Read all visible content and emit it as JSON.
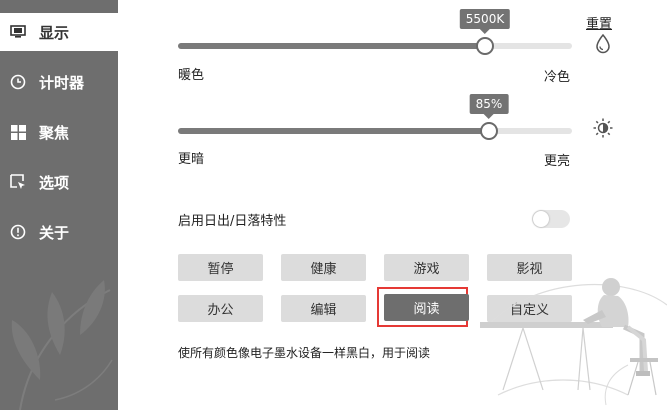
{
  "sidebar": {
    "items": [
      {
        "label": "显示",
        "icon": "monitor-icon"
      },
      {
        "label": "计时器",
        "icon": "clock-icon"
      },
      {
        "label": "聚焦",
        "icon": "windows-icon"
      },
      {
        "label": "选项",
        "icon": "cursor-icon"
      },
      {
        "label": "关于",
        "icon": "info-icon"
      }
    ]
  },
  "temperature": {
    "value_label": "5500K",
    "level": 0.78,
    "min_label": "暖色",
    "max_label": "冷色",
    "reset_label": "重置",
    "icon": "droplet-icon"
  },
  "brightness": {
    "value_label": "85%",
    "level": 0.79,
    "min_label": "更暗",
    "max_label": "更亮",
    "icon": "sun-icon"
  },
  "sunset": {
    "label": "启用日出/日落特性",
    "enabled": false
  },
  "modes": {
    "row1": [
      "暂停",
      "健康",
      "游戏",
      "影视"
    ],
    "row2": [
      "办公",
      "编辑",
      "阅读",
      "自定义"
    ],
    "active": "阅读",
    "description": "使所有颜色像电子墨水设备一样黑白，用于阅读"
  },
  "colors": {
    "sidebar": "#6e6e6e",
    "slider_fill": "#7a7a7a",
    "highlight": "#e53935"
  }
}
